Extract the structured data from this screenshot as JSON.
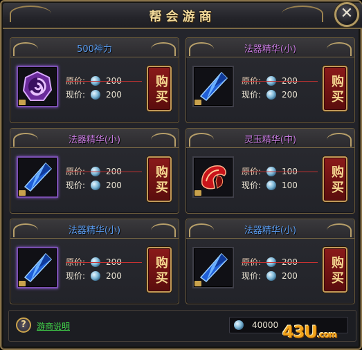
{
  "window": {
    "title": "帮会游商",
    "close_glyph": "✕"
  },
  "labels": {
    "original_price": "原价:",
    "current_price": "现价:",
    "buy": "购买"
  },
  "items": [
    {
      "name": "500神力",
      "name_color": "blue",
      "icon": "purple-swirl-token-icon",
      "original_price": "200",
      "current_price": "200"
    },
    {
      "name": "法器精华(小)",
      "name_color": "purple",
      "icon": "blue-crystal-icon",
      "original_price": "200",
      "current_price": "200"
    },
    {
      "name": "法器精华(小)",
      "name_color": "purple",
      "icon": "blue-crystal-icon",
      "original_price": "200",
      "current_price": "200"
    },
    {
      "name": "灵玉精华(中)",
      "name_color": "purple",
      "icon": "red-helmet-icon",
      "original_price": "100",
      "current_price": "100"
    },
    {
      "name": "法器精华(小)",
      "name_color": "blue",
      "icon": "blue-crystal-icon",
      "original_price": "200",
      "current_price": "200"
    },
    {
      "name": "法器精华(小)",
      "name_color": "blue",
      "icon": "blue-crystal-icon",
      "original_price": "200",
      "current_price": "200"
    }
  ],
  "footer": {
    "help_glyph": "?",
    "help_link": "游商说明",
    "balance": "40000"
  },
  "watermark": {
    "main": "43U",
    "suffix": ".com"
  },
  "colors": {
    "gold_border": "#8a744a",
    "buy_red": "#8a1a1a",
    "link_green": "#41d64a",
    "name_purple": "#c77ae0",
    "name_blue": "#5a9cf0",
    "strike_red": "#c83232"
  }
}
